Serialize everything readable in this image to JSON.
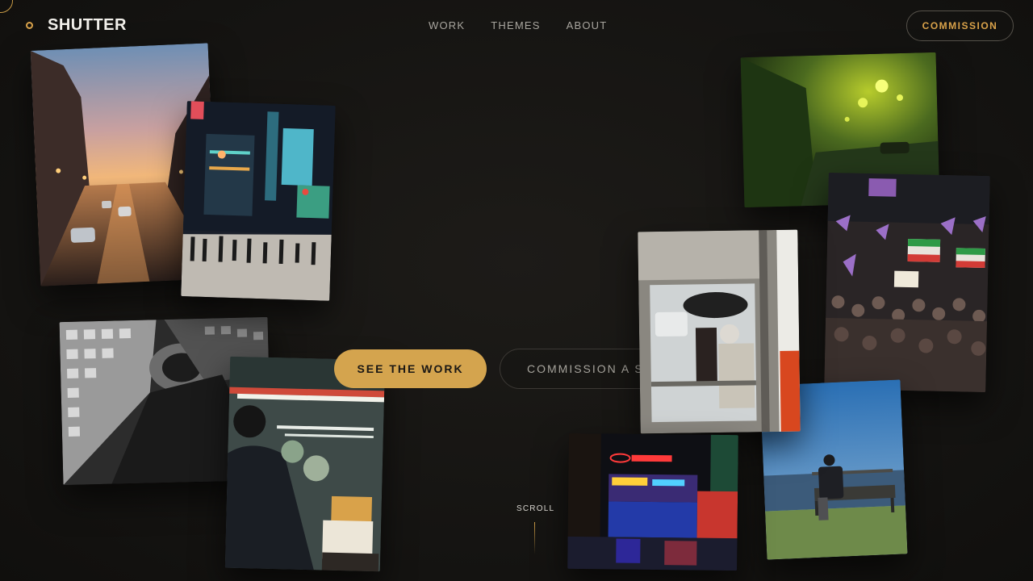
{
  "brand": {
    "name": "SHUTTER",
    "logo_icon": "ring-dot-icon"
  },
  "nav": {
    "items": [
      {
        "label": "WORK"
      },
      {
        "label": "THEMES"
      },
      {
        "label": "ABOUT"
      }
    ],
    "cta_label": "COMMISSION"
  },
  "hero": {
    "primary_cta": "SEE THE WORK",
    "secondary_cta": "COMMISSION A STORY",
    "scroll_label": "SCROLL"
  },
  "photos": [
    {
      "name": "photo-city-street-dusk"
    },
    {
      "name": "photo-times-square-crosswalk"
    },
    {
      "name": "photo-foggy-street-green"
    },
    {
      "name": "photo-protest-crowd-flags"
    },
    {
      "name": "photo-subway-window-umbrella"
    },
    {
      "name": "photo-metro-tunnel-bw"
    },
    {
      "name": "photo-market-vendor"
    },
    {
      "name": "photo-neon-saturn-storefront"
    },
    {
      "name": "photo-bench-by-water"
    }
  ],
  "colors": {
    "accent": "#d4a44e",
    "background": "#151412",
    "text": "#e8e6e1"
  }
}
